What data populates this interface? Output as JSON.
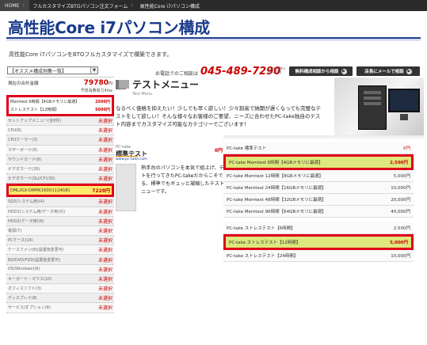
{
  "breadcrumb": {
    "home": "HOME",
    "middle": "フルカスタマイズBTOパソコン注文フォーム",
    "current": "高性能Core i7パソコン構成"
  },
  "page": {
    "title": "高性能Core i7パソコン構成",
    "intro": "高性能Core i7パソコンをBTOフルカスタマイズで構築できます。"
  },
  "contact": {
    "label": "お電話でのご相談は",
    "phone": "045-489-7290",
    "hours": "土日祝を除く 10〜19時",
    "btn_consult": "無料構成相談から相談",
    "btn_store": "店長にメールで相談"
  },
  "left": {
    "select_value": "【オススメ構成例集一覧】",
    "total_label": "現在の合計金額",
    "total_value": "79780",
    "total_unit": "円",
    "power": "予想消費電力40w",
    "selected": [
      {
        "name": "Memtest 6時間【4GBメモリに最適】",
        "price": "2500円"
      },
      {
        "name": "ストレステスト【12時間】",
        "price": "5000円"
      }
    ],
    "parts": [
      {
        "name": "セットアップメニュー(全8件)",
        "status": "未選択"
      },
      {
        "name": "CPU(6)",
        "status": "未選択"
      },
      {
        "name": "CPUクーラー(3)",
        "status": "未選択"
      },
      {
        "name": "マザーボード(9)",
        "status": "未選択"
      },
      {
        "name": "サウンドカード(8)",
        "status": "未選択"
      },
      {
        "name": "ビデオカード(26)",
        "status": "未選択"
      },
      {
        "name": "ビデオカード(SLI/CF)(30)",
        "status": "未選択"
      },
      {
        "name": "DML2GX-DIMM(1600)(1)[4GB]",
        "status": "7228円",
        "hl": true
      },
      {
        "name": "SSD(システム用)(4)",
        "status": "未選択"
      },
      {
        "name": "HDD1(システム用/データ用)(5)",
        "status": "未選択"
      },
      {
        "name": "HDD2(データ用)(6)",
        "status": "未選択"
      },
      {
        "name": "電源(7)",
        "status": "未選択"
      },
      {
        "name": "PCケース(14)",
        "status": "未選択"
      },
      {
        "name": "ケースファン(8)(設置後変更可)",
        "status": "未選択"
      },
      {
        "name": "BD/DVD/FDD(設置後変更可)",
        "status": "未選択"
      },
      {
        "name": "OS(Windows)(6)",
        "status": "未選択"
      },
      {
        "name": "キーボード・マウス(10)",
        "status": "未選択"
      },
      {
        "name": "オフィスソフト(3)",
        "status": "未選択"
      },
      {
        "name": "ディスプレイ(8)",
        "status": "未選択"
      },
      {
        "name": "サービス/オプション(8)",
        "status": "未選択"
      }
    ]
  },
  "menu": {
    "title": "テストメニュー",
    "subtitle": "Test Menu",
    "description": "なるべく価格を抑えたい！少しでも早く欲しい！少々割高で納期が遅くなっても完璧なテストをして欲しい！そんな様々なお客様のご要望、ニーズに合わせたPC-take独自のテスト内容までカスタマイズ可能なカテゴリーでございます！"
  },
  "card": {
    "brand": "PC-take",
    "name": "標準テスト",
    "url": "www.pc-take.com",
    "price": "0円",
    "description": "熟手台のパソコンを本気で組上げ、テストを行ってきたPC-takeだからこそできる、標準でもギュッと凝縮したテストメニューです。"
  },
  "options": [
    {
      "name": "PC-take 標準テスト",
      "price": "0円",
      "zero": true
    },
    {
      "name": "PC-take Memtest 6時間【4GBメモリに最適】",
      "price": "2,500円",
      "hl": true
    },
    {
      "name": "PC-take Memtest 12時間【8GBメモリに最適】",
      "price": "5,000円"
    },
    {
      "name": "PC-take Memtest 24時間【16GBメモリに最適】",
      "price": "10,000円"
    },
    {
      "name": "PC-take Memtest 48時間【32GBメモリに最適】",
      "price": "20,000円"
    },
    {
      "name": "PC-take Memtest 96時間【64GBメモリに最適】",
      "price": "40,000円"
    },
    {
      "name": "PC-take ストレステスト【6時間】",
      "price": "2,500円"
    },
    {
      "name": "PC-take ストレステスト【12時間】",
      "price": "5,000円",
      "hl": true
    },
    {
      "name": "PC-take ストレステスト【24時間】",
      "price": "10,000円"
    }
  ]
}
